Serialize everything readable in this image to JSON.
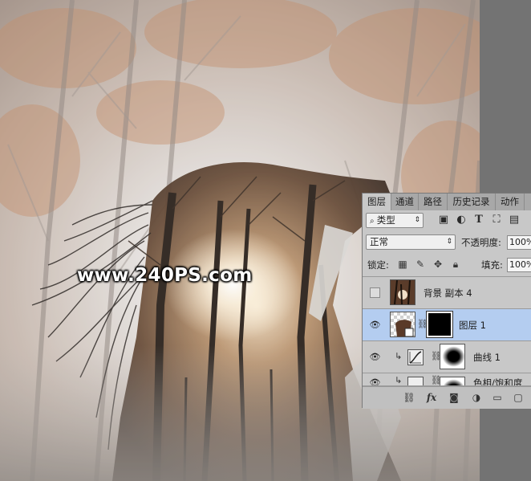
{
  "watermark": "www.240PS.com",
  "panel": {
    "tabs": [
      "图层",
      "通道",
      "路径",
      "历史记录",
      "动作"
    ],
    "active_tab": "图层",
    "filter": {
      "label": "类型",
      "icon": "search-icon"
    },
    "filter_icons": [
      "image-filter-icon",
      "adjustment-filter-icon",
      "type-filter-icon",
      "shape-filter-icon",
      "smart-object-filter-icon"
    ],
    "blend_mode": "正常",
    "opacity_label": "不透明度:",
    "opacity_value": "100%",
    "lock_label": "锁定:",
    "lock_icons": [
      "lock-transparent-icon",
      "lock-image-icon",
      "lock-position-icon",
      "lock-all-icon"
    ],
    "fill_label": "填充:",
    "fill_value": "100%",
    "layers": [
      {
        "name": "背景 副本 4",
        "visible": false,
        "selected": false,
        "has_mask": false
      },
      {
        "name": "图层 1",
        "visible": true,
        "selected": true,
        "has_mask": true
      },
      {
        "name": "曲线 1",
        "visible": true,
        "selected": false,
        "has_mask": true,
        "clipped": true
      },
      {
        "name": "色相/饱和度",
        "visible": true,
        "selected": false,
        "has_mask": true,
        "partial": true
      }
    ],
    "bottom_icons": [
      "link-icon",
      "fx-icon",
      "add-mask-icon",
      "adjustment-layer-icon",
      "group-folder-icon",
      "new-layer-icon"
    ],
    "bottom_fx_label": "fx"
  }
}
